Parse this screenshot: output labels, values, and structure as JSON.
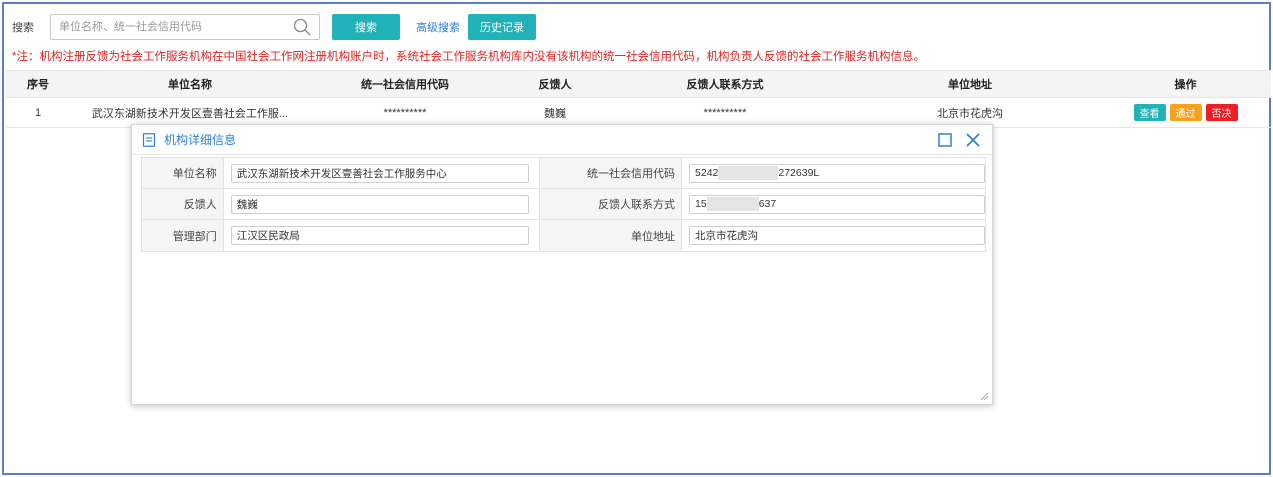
{
  "search": {
    "label": "搜索",
    "placeholder": "单位名称、统一社会信用代码",
    "value": "",
    "search_button": "搜索",
    "advanced_link": "高级搜索",
    "history_button": "历史记录"
  },
  "notice": "*注：机构注册反馈为社会工作服务机构在中国社会工作网注册机构账户时，系统社会工作服务机构库内没有该机构的统一社会信用代码，机构负责人反馈的社会工作服务机构信息。",
  "table": {
    "columns": [
      "序号",
      "单位名称",
      "统一社会信用代码",
      "反馈人",
      "反馈人联系方式",
      "单位地址",
      "操作"
    ],
    "rows": [
      {
        "index": "1",
        "name": "武汉东湖新技术开发区壹善社会工作服...",
        "credit_code": "**********",
        "feedback_person": "魏巍",
        "contact": "**********",
        "address": "北京市花虎沟",
        "actions": {
          "view": "查看",
          "pass": "通过",
          "reject": "否决"
        }
      }
    ]
  },
  "modal": {
    "title": "机构详细信息",
    "fields": {
      "unit_name_label": "单位名称",
      "unit_name": "武汉东湖新技术开发区壹善社会工作服务中心",
      "credit_code_label": "统一社会信用代码",
      "credit_code_prefix": "5242",
      "credit_code_suffix": "272639L",
      "feedback_person_label": "反馈人",
      "feedback_person": "魏巍",
      "contact_label": "反馈人联系方式",
      "contact_prefix": "15",
      "contact_suffix": "637",
      "dept_label": "管理部门",
      "dept": "江汉区民政局",
      "address_label": "单位地址",
      "address": "北京市花虎沟"
    }
  },
  "colors": {
    "accent_teal": "#20b2b8",
    "link_blue": "#2f7fd9",
    "warn_red": "#e02424",
    "pass_orange": "#f7a21b",
    "reject_red": "#ec1f26",
    "frame_blue": "#5b7fc4"
  },
  "icons": {
    "search": "magnifier-icon",
    "modal": "document-icon",
    "maximize": "maximize-icon",
    "close": "close-icon"
  }
}
